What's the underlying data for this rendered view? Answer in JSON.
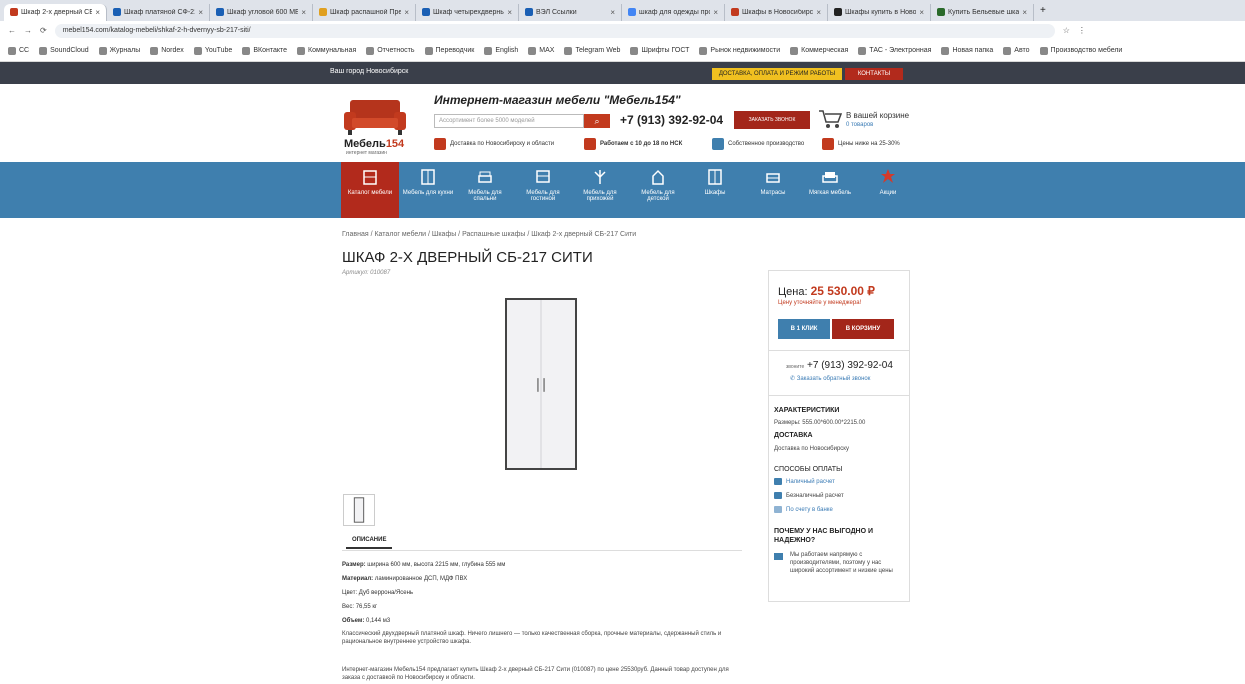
{
  "browser": {
    "tabs": [
      {
        "label": "Шкаф 2-х дверный СБ-217 С",
        "color": "#c23a1e",
        "active": true
      },
      {
        "label": "Шкаф платяной СФ-218 купи",
        "color": "#1a5fb4",
        "active": false
      },
      {
        "label": "Шкаф угловой 600 МБ Степ",
        "color": "#1a5fb4",
        "active": false
      },
      {
        "label": "Шкаф распашной Престиж",
        "color": "#e0a020",
        "active": false
      },
      {
        "label": "Шкаф четырехдверный 2 дв",
        "color": "#1a5fb4",
        "active": false
      },
      {
        "label": "ВЭЛ Ссылки",
        "color": "#1a5fb4",
        "active": false
      },
      {
        "label": "шкаф для одежды пройти",
        "color": "#4285f4",
        "active": false
      },
      {
        "label": "Шкафы в Новосибирске куп",
        "color": "#c23a1e",
        "active": false
      },
      {
        "label": "Шкафы купить в Новосиб",
        "color": "#222222",
        "active": false
      },
      {
        "label": "Купить Бельевые шкафы",
        "color": "#2a6a2a",
        "active": false
      }
    ],
    "url": "mebel154.com/katalog-mebeli/shkaf-2-h-dvernyy-sb-217-siti/",
    "bookmarks": [
      "CC",
      "SoundCloud",
      "Журналы",
      "Nordex",
      "YouTube",
      "ВКонтакте",
      "Коммунальная",
      "Отчетность",
      "Переводчик",
      "English",
      "МАХ",
      "Telegram Web",
      "Шрифты ГОСТ",
      "Рынок недвижимости",
      "Коммерческая",
      "ТАС - Электронная",
      "Новая папка",
      "Авто",
      "Производство мебели"
    ],
    "bookmarks_right": "Все закладки"
  },
  "site": {
    "city": "Ваш город Новосибирск",
    "delivery_btn": "ДОСТАВКА, ОПЛАТА И РЕЖИМ РАБОТЫ",
    "contacts_btn": "КОНТАКТЫ",
    "logo_main": "Мебель",
    "logo_num": "154",
    "logo_sub": "интернет магазин",
    "shop_title": "Интернет-магазин мебели \"Мебель154\"",
    "search_placeholder": "Ассортимент более 5000 моделей",
    "phone": "+7 (913) 392-92-04",
    "callback_btn": "ЗАКАЗАТЬ ЗВОНОК",
    "cart_text": "В вашей корзине",
    "cart_sub": "0 товаров",
    "features": [
      "Доставка по Новосибирску и области",
      "Работаем с 10 до 18 по НСК",
      "Собственное производство",
      "Цены ниже на 25-30%"
    ],
    "nav": [
      {
        "label": "Каталог мебели",
        "active": true
      },
      {
        "label": "Мебель для кухни",
        "active": false
      },
      {
        "label": "Мебель для спальни",
        "active": false
      },
      {
        "label": "Мебель для гостиной",
        "active": false
      },
      {
        "label": "Мебель для прихожей",
        "active": false
      },
      {
        "label": "Мебель для детской",
        "active": false
      },
      {
        "label": "Шкафы",
        "active": false
      },
      {
        "label": "Матрасы",
        "active": false
      },
      {
        "label": "Мягкая мебель",
        "active": false
      },
      {
        "label": "Акции",
        "active": false
      }
    ]
  },
  "product": {
    "breadcrumb": "Главная / Каталог мебели / Шкафы / Распашные шкафы / Шкаф 2-х дверный СБ-217 Сити",
    "title": "ШКАФ 2-Х ДВЕРНЫЙ СБ-217 СИТИ",
    "article": "Артикул: 010087",
    "desc_tab": "ОПИСАНИЕ",
    "specs": [
      {
        "k": "Размер:",
        "v": "ширина 600 мм, высота 2215 мм, глубина 555 мм"
      },
      {
        "k": "Материал:",
        "v": "ламинированное ДСП, МДФ ПВХ"
      },
      {
        "k": "Цвет:",
        "v": "Дуб веррона/Ясень"
      },
      {
        "k": "Вес:",
        "v": "76,55 кг"
      },
      {
        "k": "Объем:",
        "v": "0,144 м3"
      }
    ],
    "desc": "Классический двухдверный платяной шкаф. Ничего лишнего — только качественная сборка, прочные материалы, сдержанный стиль и рациональное внутреннее устройство шкафа.",
    "desc2": "Интернет-магазин Мебель154 предлагает купить Шкаф 2-х дверный СБ-217 Сити (010087) по цене 25530руб. Данный товар доступен для заказа с доставкой по Новосибирску и области."
  },
  "panel": {
    "price_label": "Цена:",
    "price": "25 530.00 ₽",
    "price_note": "Цену уточняйте у менеджера!",
    "oneclick_btn": "В 1 КЛИК",
    "tocart_btn": "В КОРЗИНУ",
    "phone_prefix": "звоните",
    "phone": "+7 (913) 392-92-04",
    "callback": "Заказать обратный звонок",
    "char_h": "ХАРАКТЕРИСТИКИ",
    "char_v": "Размеры: 555.00*600.00*2215.00",
    "deliv_h": "ДОСТАВКА",
    "deliv_v": "Доставка по Новосибирску",
    "pay_h": "СПОСОБЫ ОПЛАТЫ",
    "pay_items": [
      "Наличный расчет",
      "Безналичный расчет",
      "По счету в банке"
    ],
    "why_h": "ПОЧЕМУ У НАС ВЫГОДНО И НАДЕЖНО?",
    "why_text": "Мы работаем напрямую с производителями, поэтому у нас широкий ассортимент и низкие цены"
  }
}
